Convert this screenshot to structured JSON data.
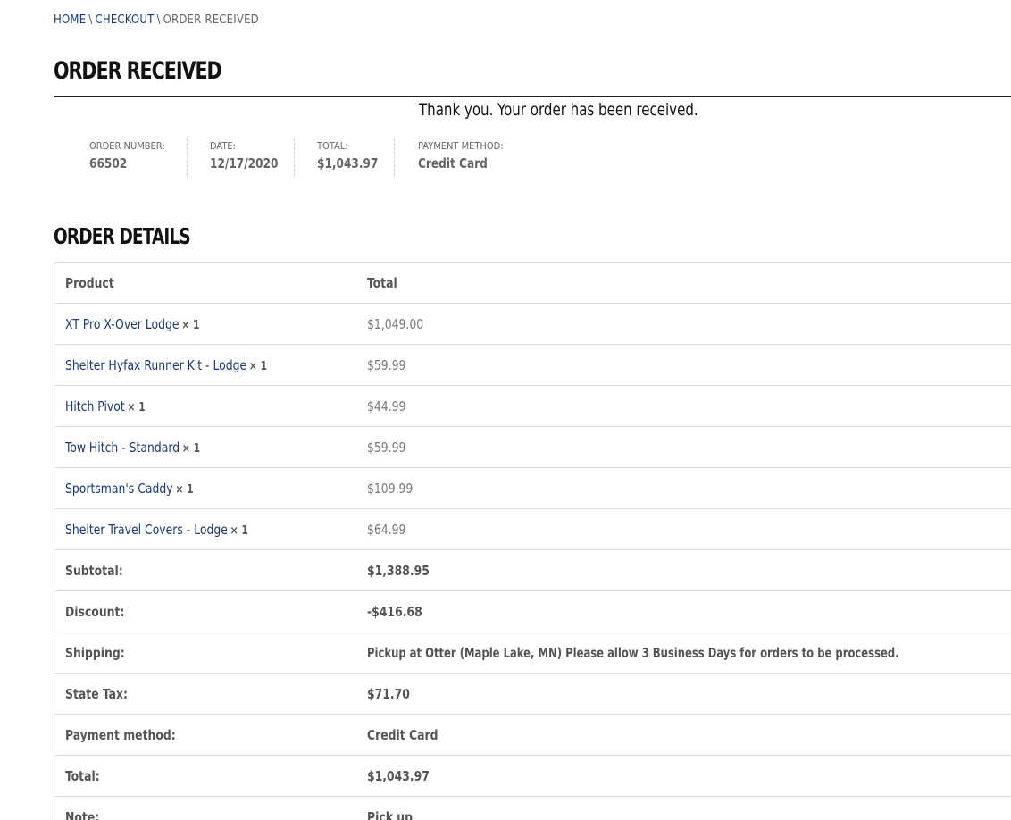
{
  "breadcrumb": {
    "items": [
      "HOME",
      "CHECKOUT",
      "ORDER RECEIVED"
    ],
    "separator": "\\"
  },
  "page": {
    "title": "ORDER RECEIVED",
    "thank_you": "Thank you. Your order has been received."
  },
  "overview": {
    "order_number": {
      "label": "ORDER NUMBER:",
      "value": "66502"
    },
    "date": {
      "label": "DATE:",
      "value": "12/17/2020"
    },
    "total": {
      "label": "TOTAL:",
      "value": "$1,043.97"
    },
    "payment_method": {
      "label": "PAYMENT METHOD:",
      "value": "Credit Card"
    }
  },
  "details": {
    "title": "ORDER DETAILS",
    "columns": [
      "Product",
      "Total"
    ],
    "items": [
      {
        "name": "XT Pro X-Over Lodge",
        "qty": "× 1",
        "total": "$1,049.00"
      },
      {
        "name": "Shelter Hyfax Runner Kit - Lodge",
        "qty": "× 1",
        "total": "$59.99"
      },
      {
        "name": "Hitch Pivot",
        "qty": "× 1",
        "total": "$44.99"
      },
      {
        "name": "Tow Hitch - Standard",
        "qty": "× 1",
        "total": "$59.99"
      },
      {
        "name": "Sportsman's Caddy",
        "qty": "× 1",
        "total": "$109.99"
      },
      {
        "name": "Shelter Travel Covers - Lodge",
        "qty": "× 1",
        "total": "$64.99"
      }
    ],
    "totals": [
      {
        "label": "Subtotal:",
        "value": "$1,388.95"
      },
      {
        "label": "Discount:",
        "value": "-$416.68"
      },
      {
        "label": "Shipping:",
        "value": "Pickup at Otter (Maple Lake, MN) Please allow 3 Business Days for orders to be processed."
      },
      {
        "label": "State Tax:",
        "value": "$71.70"
      },
      {
        "label": "Payment method:",
        "value": "Credit Card"
      },
      {
        "label": "Total:",
        "value": "$1,043.97"
      },
      {
        "label": "Note:",
        "value": "Pick up"
      }
    ]
  },
  "colors": {
    "link": "#1a3a7a",
    "heading": "#111111",
    "text": "#555555",
    "border": "#dddddd"
  }
}
